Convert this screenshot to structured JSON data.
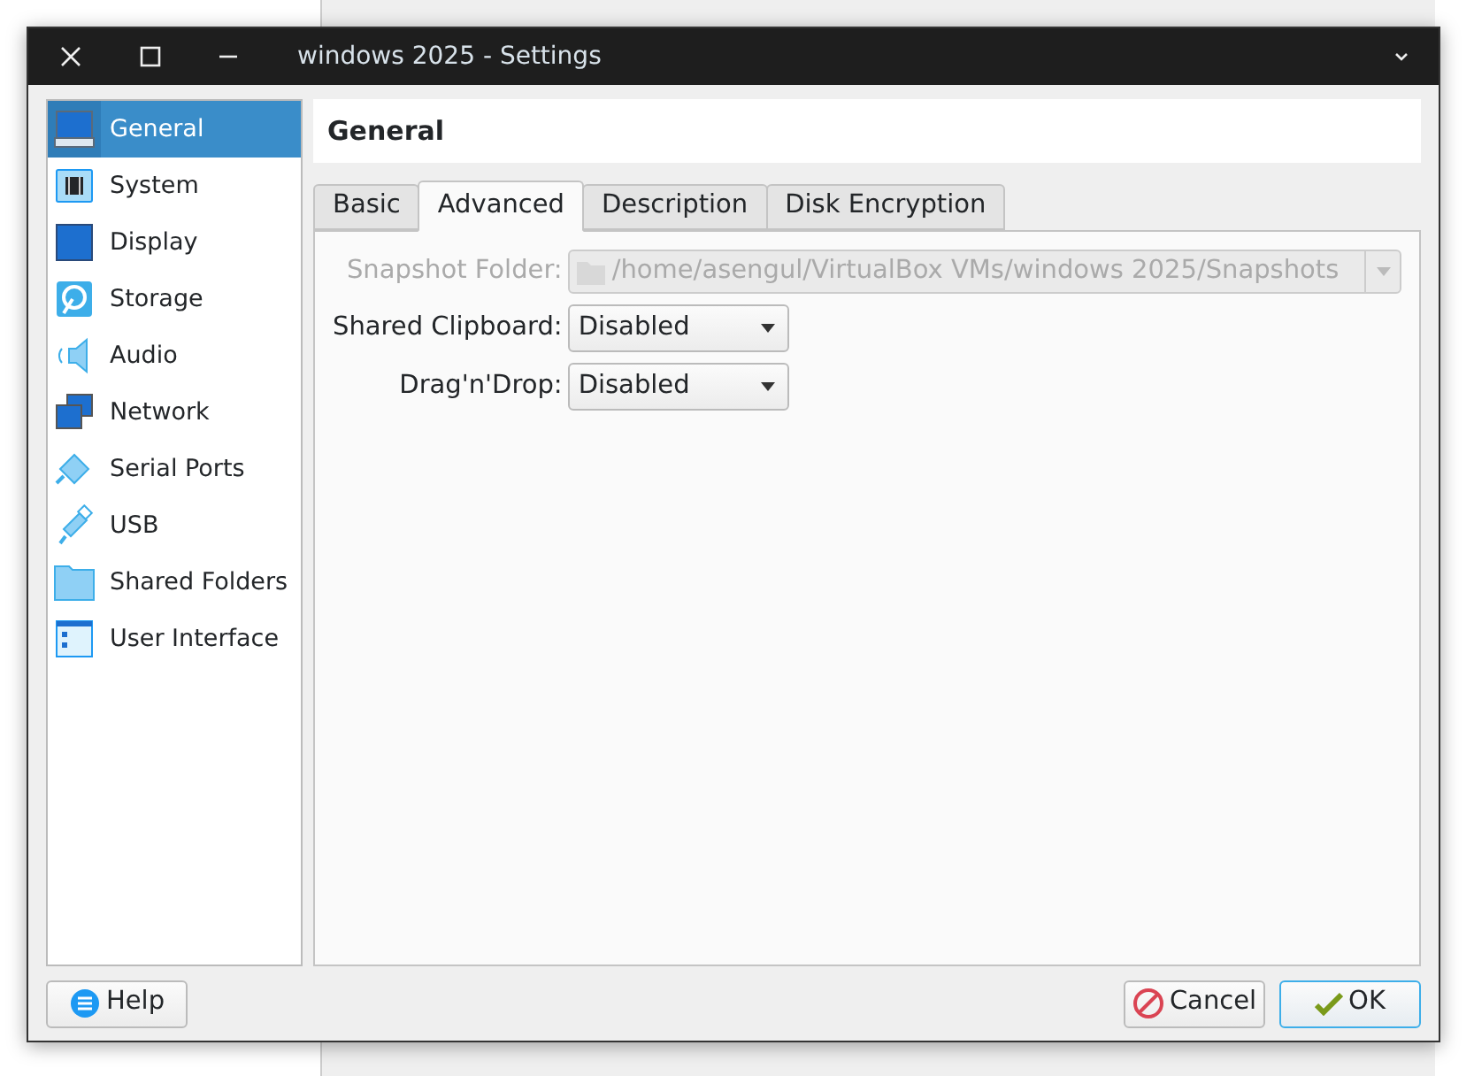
{
  "window": {
    "title": "windows 2025 - Settings"
  },
  "sidebar": {
    "items": [
      {
        "label": "General",
        "kind": "general",
        "selected": true
      },
      {
        "label": "System",
        "kind": "system",
        "selected": false
      },
      {
        "label": "Display",
        "kind": "display",
        "selected": false
      },
      {
        "label": "Storage",
        "kind": "storage",
        "selected": false
      },
      {
        "label": "Audio",
        "kind": "audio",
        "selected": false
      },
      {
        "label": "Network",
        "kind": "network",
        "selected": false
      },
      {
        "label": "Serial Ports",
        "kind": "serial",
        "selected": false
      },
      {
        "label": "USB",
        "kind": "usb",
        "selected": false
      },
      {
        "label": "Shared Folders",
        "kind": "folder",
        "selected": false
      },
      {
        "label": "User Interface",
        "kind": "ui",
        "selected": false
      }
    ]
  },
  "page_title": "General",
  "tabs": [
    {
      "label": "Basic",
      "selected": false
    },
    {
      "label": "Advanced",
      "selected": true
    },
    {
      "label": "Description",
      "selected": false
    },
    {
      "label": "Disk Encryption",
      "selected": false
    }
  ],
  "fields": [
    {
      "label": "Snapshot Folder:",
      "value": "/home/asengul/VirtualBox VMs/windows 2025/Snapshots",
      "kind": "path",
      "disabled": true
    },
    {
      "label": "Shared Clipboard:",
      "value": "Disabled",
      "kind": "combo",
      "disabled": false
    },
    {
      "label": "Drag'n'Drop:",
      "value": "Disabled",
      "kind": "combo",
      "disabled": false
    }
  ],
  "buttons": [
    {
      "label": "Help",
      "kind": "help"
    },
    {
      "label": "Cancel",
      "kind": "cancel"
    },
    {
      "label": "OK",
      "kind": "ok"
    }
  ]
}
